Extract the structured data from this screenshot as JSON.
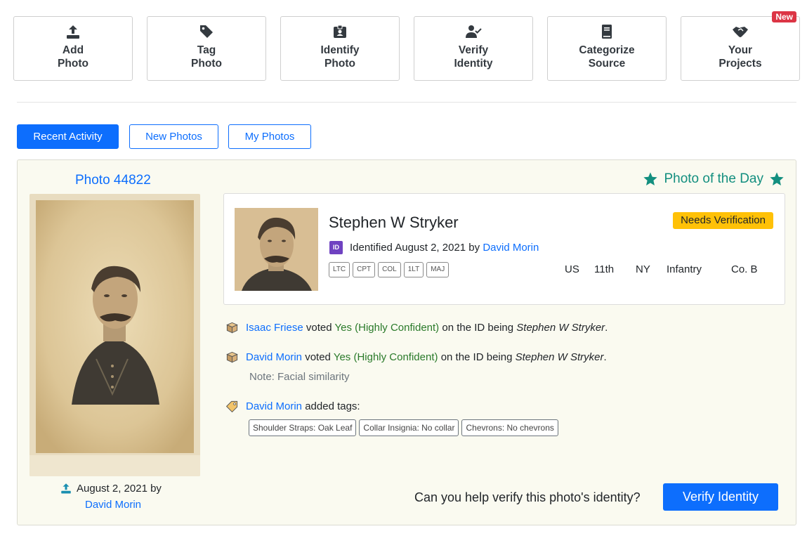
{
  "tiles": [
    {
      "line1": "Add",
      "line2": "Photo",
      "icon": "upload-icon"
    },
    {
      "line1": "Tag",
      "line2": "Photo",
      "icon": "tag-icon"
    },
    {
      "line1": "Identify",
      "line2": "Photo",
      "icon": "id-badge-icon"
    },
    {
      "line1": "Verify",
      "line2": "Identity",
      "icon": "user-check-icon"
    },
    {
      "line1": "Categorize",
      "line2": "Source",
      "icon": "book-icon"
    },
    {
      "line1": "Your",
      "line2": "Projects",
      "icon": "handshake-icon",
      "badge": "New"
    }
  ],
  "tabs": [
    "Recent Activity",
    "New Photos",
    "My Photos"
  ],
  "active_tab": "Recent Activity",
  "photo": {
    "id_label": "Photo 44822",
    "potd_label": "Photo of the Day",
    "upload_date": "August 2, 2021 by",
    "uploader": "David Morin"
  },
  "identification": {
    "name": "Stephen W Stryker",
    "status_badge": "Needs Verification",
    "id_icon_text": "ID",
    "identified_text": "Identified August 2, 2021 by",
    "identified_by": "David Morin",
    "ranks": [
      "LTC",
      "CPT",
      "COL",
      "1LT",
      "MAJ"
    ],
    "unit": {
      "country": "US",
      "number": "11th",
      "state": "NY",
      "branch": "Infantry",
      "company": "Co. B"
    }
  },
  "activity": [
    {
      "user": "Isaac Friese",
      "mid": "voted",
      "vote": "Yes (Highly Confident)",
      "tail": "on the ID being",
      "subject": "Stephen W Stryker",
      "end": "."
    },
    {
      "user": "David Morin",
      "mid": "voted",
      "vote": "Yes (Highly Confident)",
      "tail": "on the ID being",
      "subject": "Stephen W Stryker",
      "end": ".",
      "note": "Note: Facial similarity"
    },
    {
      "user": "David Morin",
      "mid": "added tags:",
      "tags": [
        "Shoulder Straps: Oak Leaf",
        "Collar Insignia: No collar",
        "Chevrons: No chevrons"
      ]
    }
  ],
  "cta": {
    "question": "Can you help verify this photo's identity?",
    "button": "Verify Identity"
  },
  "colors": {
    "primary": "#0d6efd",
    "teal": "#138f7f",
    "warning": "#ffc107",
    "danger": "#dc3545",
    "panel_bg": "#fafaf0"
  }
}
